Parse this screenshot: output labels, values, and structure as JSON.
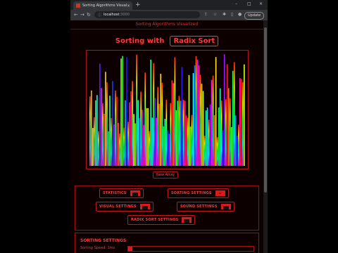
{
  "browser": {
    "tab_title": "Sorting Algorithms Visualized",
    "tab_close": "×",
    "new_tab": "+",
    "url_host": "localhost",
    "url_port": ":3000",
    "update_label": "Update",
    "window_controls": [
      "–",
      "□",
      "×"
    ]
  },
  "app": {
    "title": "Sorting Algorithms Visualized",
    "heading_prefix": "Sorting with",
    "algorithm": "Radix Sort",
    "new_array_label": "New Array"
  },
  "settings_buttons": {
    "statistics": "Statistics",
    "sorting_settings": "Sorting Settings",
    "visual_settings": "Visual Settings",
    "sound_settings": "Sound Settings",
    "radix_sort_settings": "Radix Sort Settings"
  },
  "sorting_panel": {
    "title": "Sorting Settings",
    "speed_label": "Sorting Speed: 1ms",
    "speed_level": 0.0
  },
  "colors": {
    "accent": "#ff3a3a",
    "border": "#b01818",
    "page_bg": "#0d0000"
  }
}
